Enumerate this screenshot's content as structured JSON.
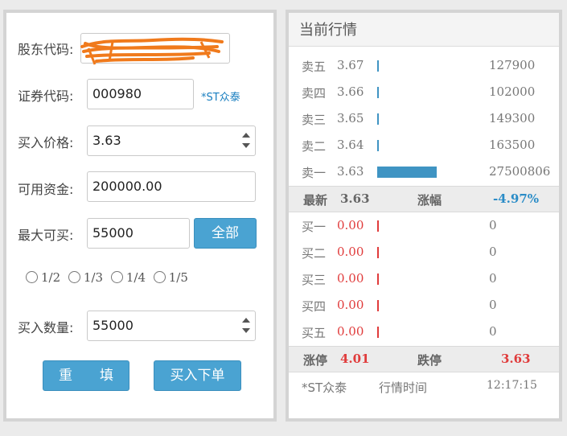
{
  "order": {
    "shareholder_code_label": "股东代码:",
    "security_code_label": "证券代码:",
    "security_code_value": "000980",
    "stock_name": "*ST众泰",
    "buy_price_label": "买入价格:",
    "buy_price_value": "3.63",
    "available_funds_label": "可用资金:",
    "available_funds_value": "200000.00",
    "max_buy_label": "最大可买:",
    "max_buy_value": "55000",
    "all_button": "全部",
    "fractions": [
      "1/2",
      "1/3",
      "1/4",
      "1/5"
    ],
    "quantity_label": "买入数量:",
    "quantity_value": "55000",
    "reset_button": "重　　填",
    "submit_button": "买入下单"
  },
  "market": {
    "title": "当前行情",
    "sell_levels": [
      {
        "label": "卖五",
        "price": "3.67",
        "volume": "127900",
        "bar_fraction": 0.003
      },
      {
        "label": "卖四",
        "price": "3.66",
        "volume": "102000",
        "bar_fraction": 0.003
      },
      {
        "label": "卖三",
        "price": "3.65",
        "volume": "149300",
        "bar_fraction": 0.003
      },
      {
        "label": "卖二",
        "price": "3.64",
        "volume": "163500",
        "bar_fraction": 0.003
      },
      {
        "label": "卖一",
        "price": "3.63",
        "volume": "27500806",
        "bar_fraction": 1.0
      }
    ],
    "latest_label": "最新",
    "latest_price": "3.63",
    "change_label": "涨幅",
    "change_value": "-4.97%",
    "buy_levels": [
      {
        "label": "买一",
        "price": "0.00",
        "volume": "0",
        "bar_fraction": 0.0
      },
      {
        "label": "买二",
        "price": "0.00",
        "volume": "0",
        "bar_fraction": 0.0
      },
      {
        "label": "买三",
        "price": "0.00",
        "volume": "0",
        "bar_fraction": 0.0
      },
      {
        "label": "买四",
        "price": "0.00",
        "volume": "0",
        "bar_fraction": 0.0
      },
      {
        "label": "买五",
        "price": "0.00",
        "volume": "0",
        "bar_fraction": 0.0
      }
    ],
    "limit_up_label": "涨停",
    "limit_up_value": "4.01",
    "limit_down_label": "跌停",
    "limit_down_value": "3.63",
    "footer_stock": "*ST众泰",
    "footer_time_label": "行情时间",
    "footer_time": "12:17:15"
  },
  "colors": {
    "accent": "#4aa3d2",
    "sell_bar": "#3f94c3",
    "buy": "#e03b3b",
    "change": "#2a8cc7",
    "scribble": "#f07a1c"
  }
}
